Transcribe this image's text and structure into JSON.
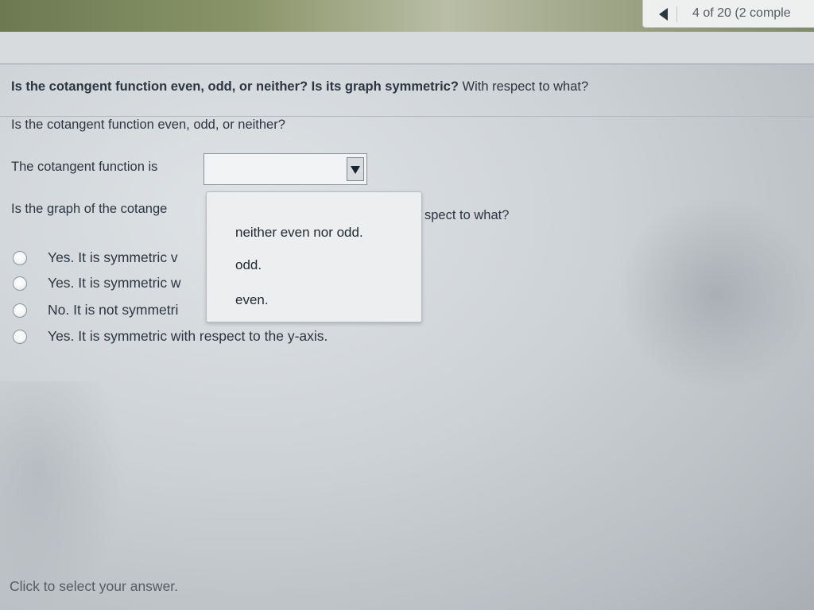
{
  "nav": {
    "counter": "4 of 20 (2 comple"
  },
  "question": {
    "main": "Is the cotangent function even, odd, or neither? Is its graph symmetric?",
    "main_suffix": " With respect to what?",
    "part_a": "Is the cotangent function even, odd, or neither?",
    "part_a_sentence": "The cotangent function is",
    "part_a_select_value": "",
    "part_b_visible_start": "Is the graph of the cotange",
    "part_b_visible_end": "spect to what?"
  },
  "dropdown": {
    "options": [
      "neither even nor odd.",
      "odd.",
      "even."
    ]
  },
  "choices": [
    {
      "text": "Yes. It is symmetric v"
    },
    {
      "text": "Yes. It is symmetric w"
    },
    {
      "text": "No. It is not symmetri"
    },
    {
      "text": "Yes. It is symmetric with respect to the y-axis."
    }
  ],
  "footer": {
    "hint": "Click to select your answer."
  },
  "colors": {
    "text": "#2b3540",
    "panel": "#eceeef",
    "border": "#8a9096"
  },
  "icons": {
    "nav_prev": "left-triangle-icon",
    "select_arrow": "down-triangle-icon"
  }
}
